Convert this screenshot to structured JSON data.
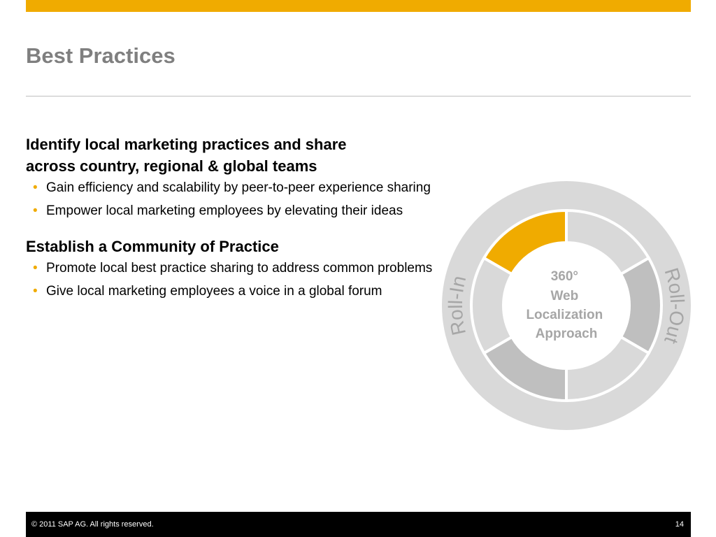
{
  "slide": {
    "title": "Best Practices",
    "sections": [
      {
        "heading_line1": "Identify local marketing practices and share",
        "heading_line2": "across country, regional & global teams",
        "bullets": [
          "Gain efficiency and scalability by peer-to-peer experience sharing",
          "Empower local marketing employees by elevating their ideas"
        ]
      },
      {
        "heading": "Establish a Community of Practice",
        "bullets": [
          "Promote local best practice sharing to address common problems",
          "Give local marketing employees a voice in a global forum"
        ]
      }
    ],
    "bullet_glyph": "•"
  },
  "diagram": {
    "center_line1": "360°",
    "center_line2": "Web",
    "center_line3": "Localization",
    "center_line4": "Approach",
    "left_label": "Roll-In",
    "right_label": "Roll-Out",
    "segment_colors": [
      "#d9d9d9",
      "#bfbfbf",
      "#d9d9d9",
      "#bfbfbf",
      "#d9d9d9",
      "#f0ab00"
    ],
    "highlight_segment": 6,
    "segment_count": 6
  },
  "footer": {
    "copyright": "©  2011 SAP AG. All rights reserved.",
    "page_number": "14"
  },
  "colors": {
    "accent": "#f0ab00",
    "title_gray": "#7f7f7f",
    "ring_gray": "#d9d9d9",
    "footer_bg": "#000000"
  }
}
